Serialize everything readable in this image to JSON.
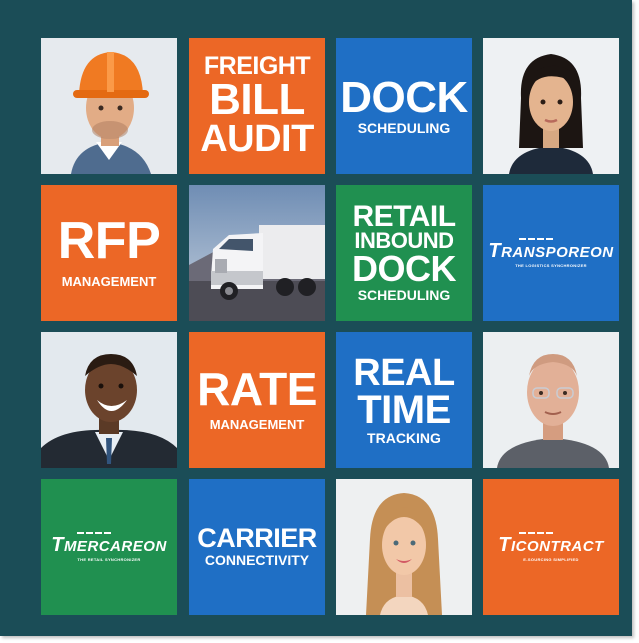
{
  "tiles": {
    "freight": {
      "line1": "FREIGHT",
      "line2": "BILL",
      "line3": "AUDIT"
    },
    "dock": {
      "line1": "DOCK",
      "line2": "SCHEDULING"
    },
    "rfp": {
      "line1": "RFP",
      "line2": "MANAGEMENT"
    },
    "retail": {
      "line1": "RETAIL",
      "line2": "INBOUND",
      "line3": "DOCK",
      "line4": "SCHEDULING"
    },
    "transporeon": {
      "name": "RANSPOREON",
      "tagline": "THE LOGISTICS SYNCHRONIZER"
    },
    "rate": {
      "line1": "RATE",
      "line2": "MANAGEMENT"
    },
    "realtime": {
      "line1": "REAL",
      "line2": "TIME",
      "line3": "TRACKING"
    },
    "mercareon": {
      "name": "MERCAREON",
      "tagline": "THE RETAIL SYNCHRONIZER"
    },
    "carrier": {
      "line1": "CARRIER",
      "line2": "CONNECTIVITY"
    },
    "ticontract": {
      "name": "ICONTRACT",
      "tagline": "E-SOURCING SIMPLIFIED"
    }
  },
  "colors": {
    "background": "#1b4d57",
    "orange": "#ec6726",
    "blue": "#1f6fc5",
    "green": "#209050"
  },
  "photos": {
    "worker": "construction-worker-photo",
    "woman": "woman-photo",
    "truck": "truck-photo",
    "smiling_man": "smiling-man-photo",
    "bald_man": "bald-man-photo",
    "blonde_woman": "blonde-woman-photo"
  }
}
